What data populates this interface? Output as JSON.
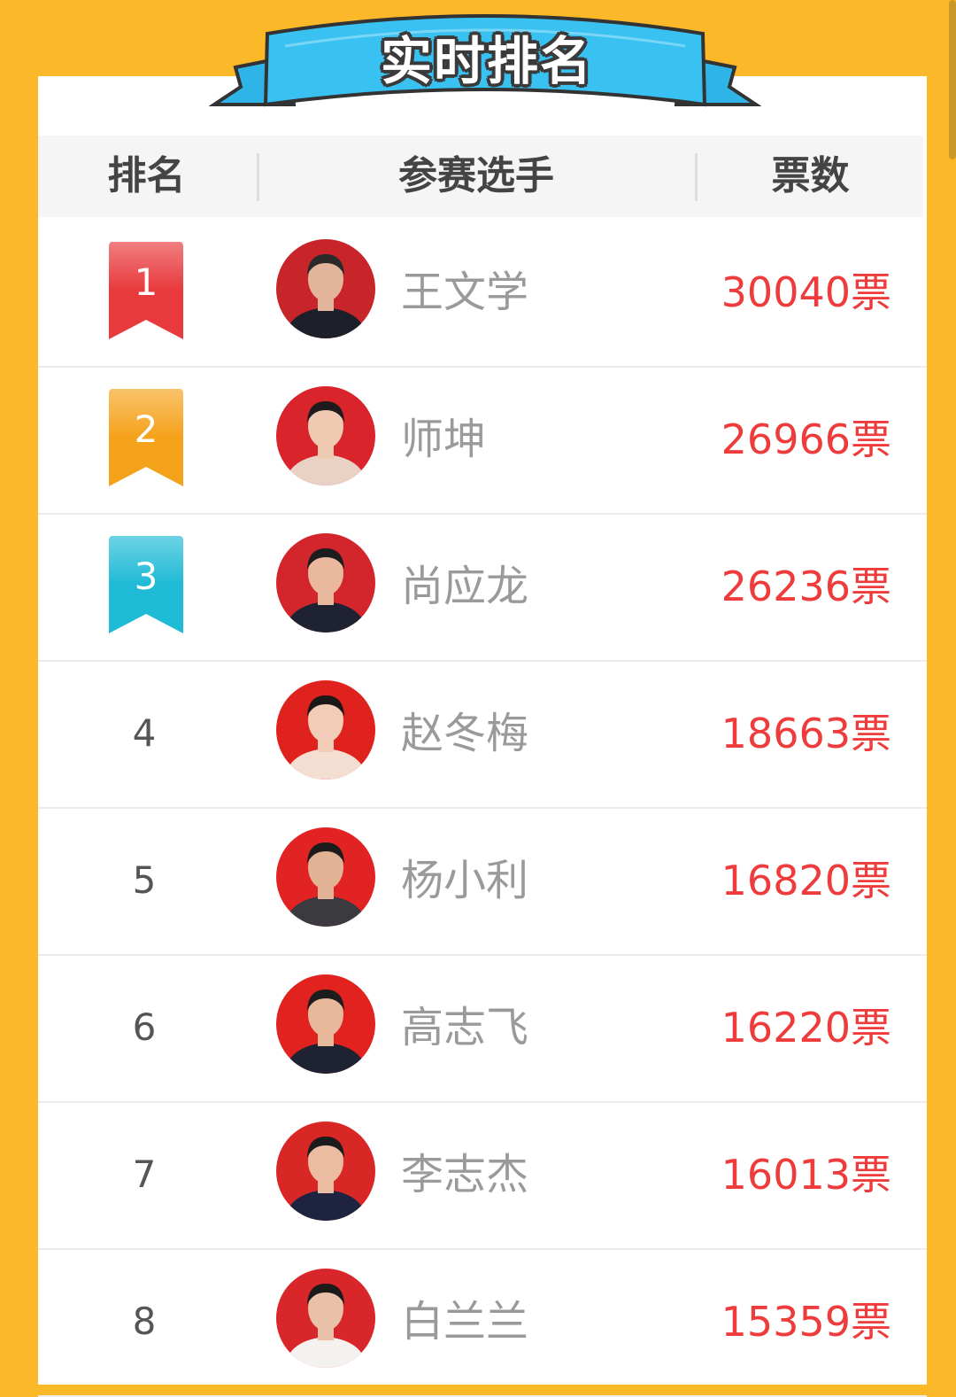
{
  "title": "实时排名",
  "headers": {
    "rank": "排名",
    "contestant": "参赛选手",
    "votes": "票数"
  },
  "colors": {
    "background": "#fbb828",
    "banner": "#39c1f2",
    "votes": "#ee3b3b",
    "gold": "#e8393c",
    "silver": "#f5a21b",
    "bronze": "#1fbad6"
  },
  "rows": [
    {
      "rank": "1",
      "name": "王文学",
      "votes": "30040票",
      "avatar_bg": "#c8252b",
      "suit": "#1d1f2b",
      "skin": "#e2b59a",
      "hair": "#2a2a2a"
    },
    {
      "rank": "2",
      "name": "师坤",
      "votes": "26966票",
      "avatar_bg": "#d8242a",
      "suit": "#e9d2c4",
      "skin": "#f0c9b2",
      "hair": "#1d1b1b"
    },
    {
      "rank": "3",
      "name": "尚应龙",
      "votes": "26236票",
      "avatar_bg": "#d3262c",
      "suit": "#1e2233",
      "skin": "#eab89c",
      "hair": "#1d1d1d"
    },
    {
      "rank": "4",
      "name": "赵冬梅",
      "votes": "18663票",
      "avatar_bg": "#e0221f",
      "suit": "#f4ded2",
      "skin": "#f2ccb6",
      "hair": "#1c1818"
    },
    {
      "rank": "5",
      "name": "杨小利",
      "votes": "16820票",
      "avatar_bg": "#e12323",
      "suit": "#3a3a3f",
      "skin": "#e2b295",
      "hair": "#1c1c1c"
    },
    {
      "rank": "6",
      "name": "高志飞",
      "votes": "16220票",
      "avatar_bg": "#e2221f",
      "suit": "#1f2233",
      "skin": "#e7b89a",
      "hair": "#1d1d1d"
    },
    {
      "rank": "7",
      "name": "李志杰",
      "votes": "16013票",
      "avatar_bg": "#d92726",
      "suit": "#1e2440",
      "skin": "#ebbc9f",
      "hair": "#1b1b1b"
    },
    {
      "rank": "8",
      "name": "白兰兰",
      "votes": "15359票",
      "avatar_bg": "#d8262a",
      "suit": "#f4f1ee",
      "skin": "#e8c1a8",
      "hair": "#1d1a1a"
    }
  ]
}
